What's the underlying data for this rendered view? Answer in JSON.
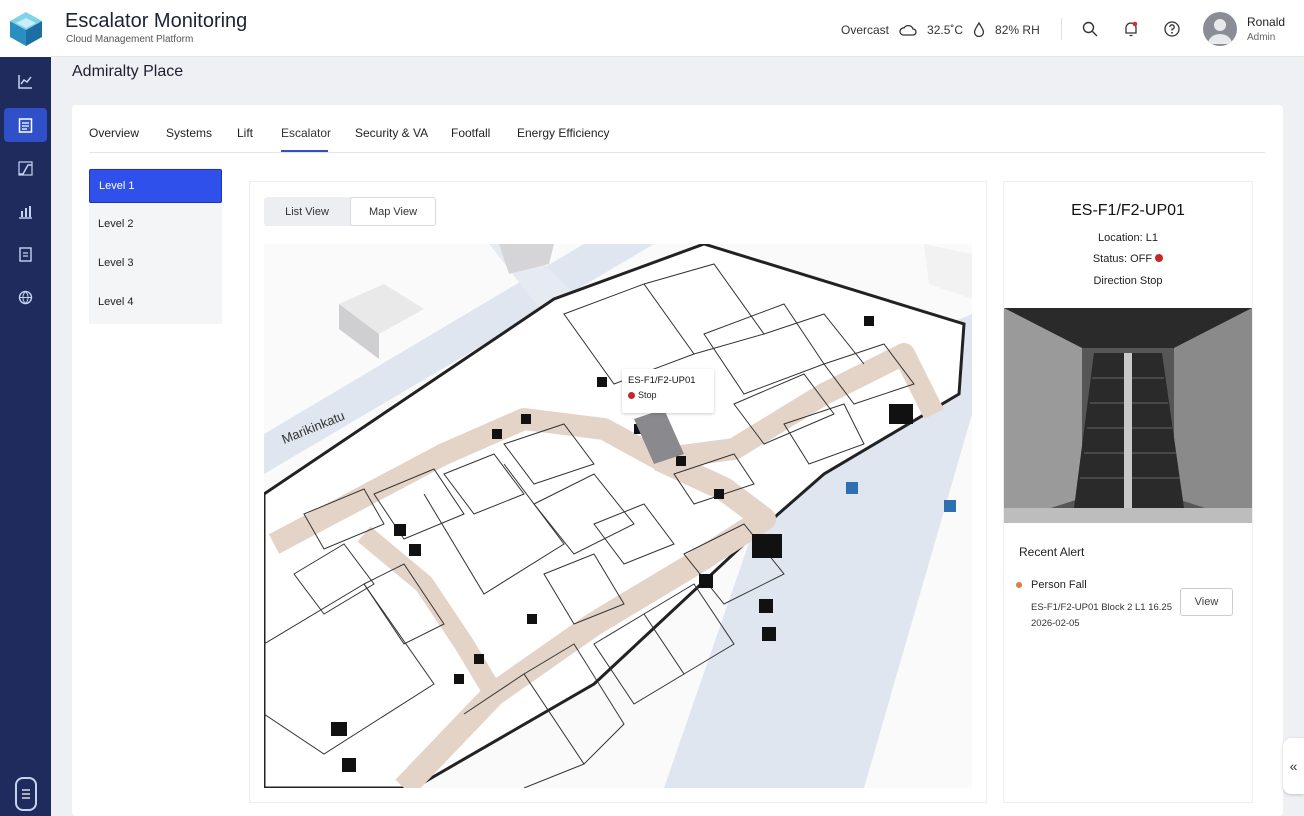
{
  "app": {
    "title": "Escalator Monitoring",
    "subtitle": "Cloud Management Platform"
  },
  "weather": {
    "condition": "Overcast",
    "temperature": "32.5˚C",
    "humidity": "82% RH"
  },
  "user": {
    "name": "Ronald",
    "role": "Admin"
  },
  "sidebar": {
    "items": [
      {
        "icon": "line-chart-icon",
        "active": false
      },
      {
        "icon": "list-document-icon",
        "active": true
      },
      {
        "icon": "escalator-icon",
        "active": false
      },
      {
        "icon": "bar-chart-icon",
        "active": false
      },
      {
        "icon": "report-icon",
        "active": false
      },
      {
        "icon": "globe-icon",
        "active": false
      }
    ],
    "bottom_icon": "menu-icon"
  },
  "page": {
    "title": "Admiralty Place"
  },
  "tabs": [
    {
      "label": "Overview",
      "active": false
    },
    {
      "label": "Systems",
      "active": false
    },
    {
      "label": "Lift",
      "active": false
    },
    {
      "label": "Escalator",
      "active": true
    },
    {
      "label": "Security & VA",
      "active": false
    },
    {
      "label": "Footfall",
      "active": false
    },
    {
      "label": "Energy Efficiency",
      "active": false
    }
  ],
  "levels": [
    {
      "label": "Level 1",
      "active": true
    },
    {
      "label": "Level 2",
      "active": false
    },
    {
      "label": "Level 3",
      "active": false
    },
    {
      "label": "Level 4",
      "active": false
    }
  ],
  "view_toggle": {
    "list_label": "List View",
    "map_label": "Map View",
    "active": "map"
  },
  "map": {
    "street_label": "Marikinkatu",
    "tooltip": {
      "name": "ES-F1/F2-UP01",
      "status": "Stop"
    }
  },
  "detail": {
    "title": "ES-F1/F2-UP01",
    "location": "Location: L1",
    "status": "Status: OFF",
    "direction": "Direction Stop"
  },
  "alert": {
    "section_title": "Recent Alert",
    "type": "Person Fall",
    "detail": "ES-F1/F2-UP01 Block 2 L1 16.25",
    "date": "2026-02-05",
    "view_label": "View"
  },
  "colors": {
    "sidebar_bg": "#1e2b5c",
    "accent": "#2f50ea",
    "status_off": "#c62828",
    "alert_dot": "#e07a3f"
  }
}
